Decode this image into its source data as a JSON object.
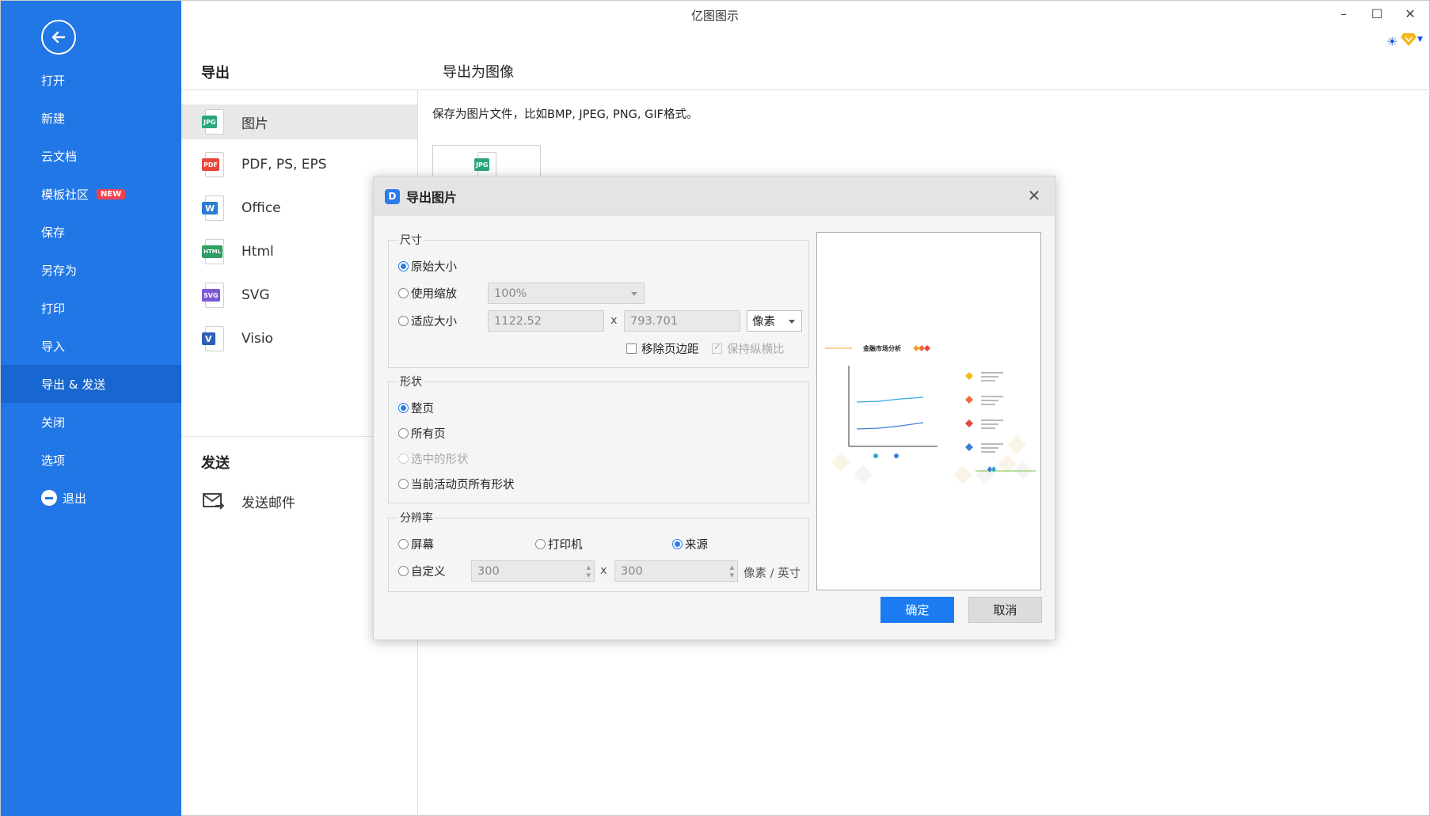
{
  "window": {
    "title": "亿图图示",
    "minimize_glyph": "–",
    "maximize_glyph": "☐",
    "close_glyph": "✕"
  },
  "sidebar": {
    "items": [
      {
        "label": "打开"
      },
      {
        "label": "新建"
      },
      {
        "label": "云文档"
      },
      {
        "label": "模板社区",
        "badge": "NEW"
      },
      {
        "label": "保存"
      },
      {
        "label": "另存为"
      },
      {
        "label": "打印"
      },
      {
        "label": "导入"
      },
      {
        "label": "导出 & 发送",
        "active": true
      },
      {
        "label": "关闭"
      },
      {
        "label": "选项"
      },
      {
        "label": "退出"
      }
    ]
  },
  "export": {
    "heading": "导出",
    "items": [
      {
        "label": "图片",
        "tag": "JPG",
        "tag_color": "#2aa57f"
      },
      {
        "label": "PDF, PS, EPS",
        "tag": "PDF",
        "tag_color": "#e8453c"
      },
      {
        "label": "Office",
        "tag": "W",
        "tag_color": "#2b7cd3"
      },
      {
        "label": "Html",
        "tag": "HTML",
        "tag_color": "#2e9e62"
      },
      {
        "label": "SVG",
        "tag": "SVG",
        "tag_color": "#7b59d6"
      },
      {
        "label": "Visio",
        "tag": "V",
        "tag_color": "#2f5fb8"
      }
    ],
    "send_heading": "发送",
    "send_item": "发送邮件"
  },
  "panel": {
    "title": "导出为图像",
    "description": "保存为图片文件，比如BMP, JPEG, PNG, GIF格式。",
    "card_tag": "JPG"
  },
  "dialog": {
    "title": "导出图片",
    "size": {
      "legend": "尺寸",
      "original": "原始大小",
      "use_zoom": "使用缩放",
      "zoom_value": "100%",
      "fit_size": "适应大小",
      "width": "1122.52",
      "x": "x",
      "height": "793.701",
      "unit": "像素",
      "remove_margin": "移除页边距",
      "keep_ratio": "保持纵横比"
    },
    "shape": {
      "legend": "形状",
      "whole_page": "整页",
      "all_pages": "所有页",
      "selected": "选中的形状",
      "current_all": "当前活动页所有形状"
    },
    "resolution": {
      "legend": "分辨率",
      "screen": "屏幕",
      "printer": "打印机",
      "source": "来源",
      "custom": "自定义",
      "dpi_x": "300",
      "x": "x",
      "dpi_y": "300",
      "unit": "像素 / 英寸"
    },
    "ok": "确定",
    "cancel": "取消"
  },
  "preview": {
    "chart_title": "金融市场分析"
  },
  "colors": {
    "sidebar": "#2177e6",
    "accent": "#1a7cf0"
  }
}
